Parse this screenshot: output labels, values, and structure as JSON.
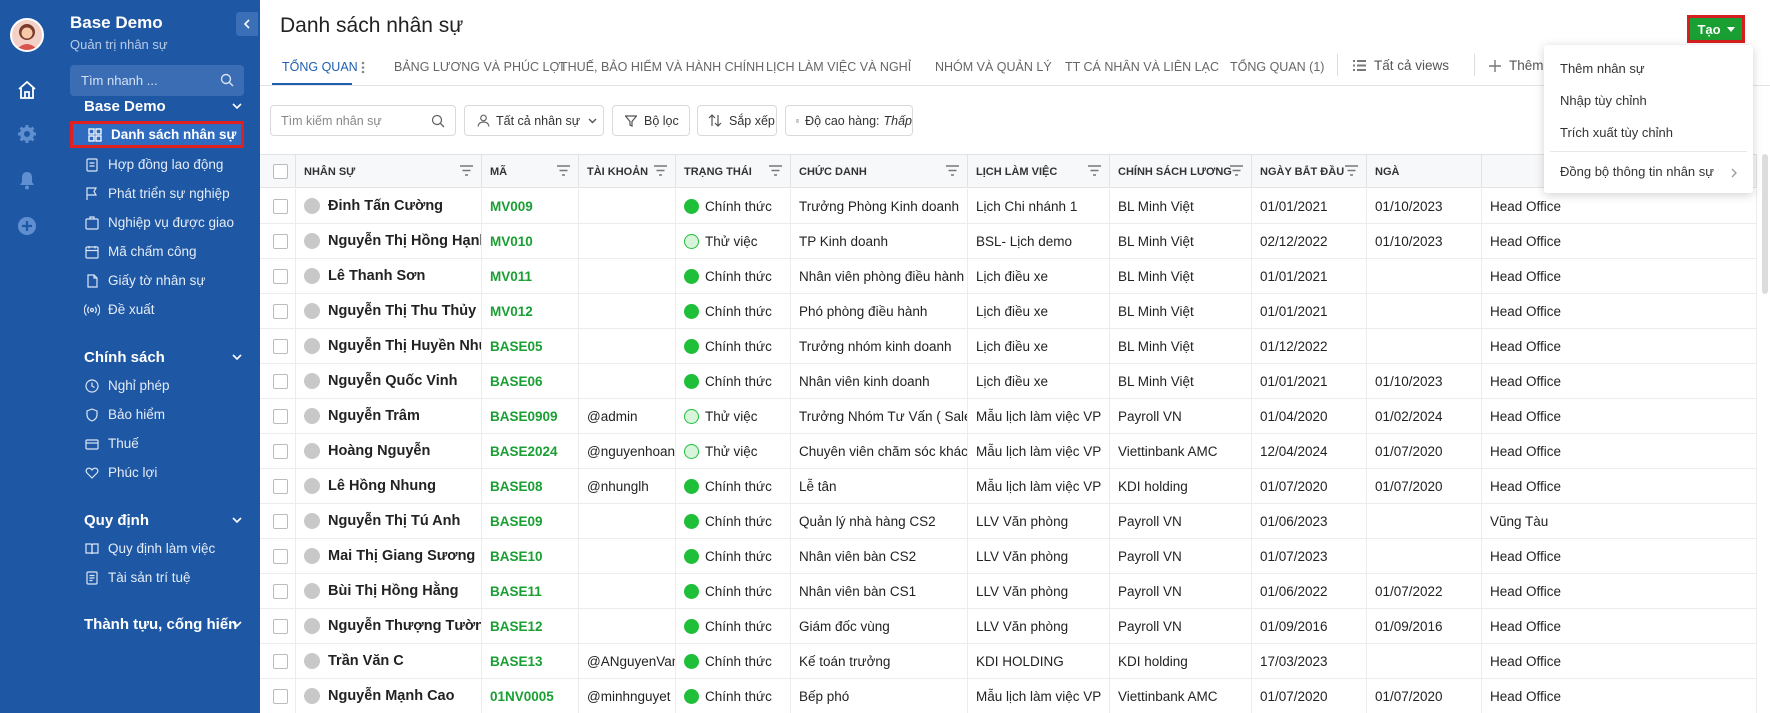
{
  "app": {
    "title": "Base Demo",
    "subtitle": "Quản trị nhân sự"
  },
  "colors": {
    "sidebar": "#1e57a4",
    "accent": "#1e5fb0",
    "create": "#1a9f33",
    "status": "#1fbf3a",
    "highlight": "#e02020"
  },
  "rail": {
    "icons": [
      "home-icon",
      "gear-icon",
      "bell-icon",
      "plus-circle-icon"
    ]
  },
  "sidebar": {
    "search_placeholder": "Tìm nhanh ...",
    "sections": [
      {
        "title": "Base Demo",
        "items": [
          {
            "label": "Danh sách nhân sự",
            "icon": "grid-icon",
            "active": true
          },
          {
            "label": "Hợp đồng lao động",
            "icon": "document-icon"
          },
          {
            "label": "Phát triển sự nghiệp",
            "icon": "flag-icon"
          },
          {
            "label": "Nghiệp vụ được giao",
            "icon": "task-icon"
          },
          {
            "label": "Mã chấm công",
            "icon": "calendar-icon"
          },
          {
            "label": "Giấy tờ nhân sự",
            "icon": "paper-icon"
          },
          {
            "label": "Đề xuất",
            "icon": "broadcast-icon"
          }
        ]
      },
      {
        "title": "Chính sách",
        "items": [
          {
            "label": "Nghỉ phép",
            "icon": "clock-icon"
          },
          {
            "label": "Bảo hiểm",
            "icon": "shield-icon"
          },
          {
            "label": "Thuế",
            "icon": "card-icon"
          },
          {
            "label": "Phúc lợi",
            "icon": "heart-icon"
          }
        ]
      },
      {
        "title": "Quy định",
        "items": [
          {
            "label": "Quy định làm việc",
            "icon": "book-icon"
          },
          {
            "label": "Tài sản trí tuệ",
            "icon": "file-icon"
          }
        ]
      },
      {
        "title": "Thành tựu, cống hiến",
        "items": []
      }
    ]
  },
  "main": {
    "title": "Danh sách nhân sự",
    "create_label": "Tạo",
    "tabs": [
      "TỔNG QUAN",
      "BẢNG LƯƠNG VÀ PHÚC LỢI",
      "THUẾ, BẢO HIỂM VÀ HÀNH CHÍNH",
      "LỊCH LÀM VIỆC VÀ NGHỈ",
      "NHÓM VÀ QUẢN LÝ",
      "TT CÁ NHÂN VÀ LIÊN LẠC",
      "TỔNG QUAN (1)"
    ],
    "all_views": "Tất cả views",
    "add_view": "Thêm",
    "toolbar": {
      "search_placeholder": "Tìm kiếm nhân sự",
      "scope": "Tất cả nhân sự",
      "filter": "Bộ lọc",
      "sort": "Sắp xếp",
      "row_height_label": "Độ cao hàng:",
      "row_height_value": "Thấp"
    },
    "dropdown": [
      "Thêm nhân sự",
      "Nhập tùy chỉnh",
      "Trích xuất tùy chỉnh",
      "Đồng bộ thông tin nhân sự"
    ]
  },
  "table": {
    "columns": [
      "NHÂN SỰ",
      "MÃ",
      "TÀI KHOẢN",
      "TRẠNG THÁI",
      "CHỨC DANH",
      "LỊCH LÀM VIỆC",
      "CHÍNH SÁCH LƯƠNG",
      "NGÀY BẮT ĐẦU",
      "NGÀ"
    ],
    "rows": [
      {
        "name": "Đinh Tấn Cường",
        "code": "MV009",
        "account": "",
        "status": "Chính thức",
        "title": "Trưởng Phòng Kinh doanh",
        "schedule": "Lịch Chi nhánh 1",
        "salary": "BL Minh Việt",
        "start": "01/01/2021",
        "end": "01/10/2023",
        "office": "Head Office"
      },
      {
        "name": "Nguyễn Thị Hồng Hạnh",
        "code": "MV010",
        "account": "",
        "status": "Thử việc",
        "title": "TP Kinh doanh",
        "schedule": "BSL- Lịch demo",
        "salary": "BL Minh Việt",
        "start": "02/12/2022",
        "end": "01/10/2023",
        "office": "Head Office"
      },
      {
        "name": "Lê Thanh Sơn",
        "code": "MV011",
        "account": "",
        "status": "Chính thức",
        "title": "Nhân viên phòng điều hành",
        "schedule": "Lịch điều xe",
        "salary": "BL Minh Việt",
        "start": "01/01/2021",
        "end": "",
        "office": "Head Office"
      },
      {
        "name": "Nguyễn Thị Thu Thủy",
        "code": "MV012",
        "account": "",
        "status": "Chính thức",
        "title": "Phó phòng điều hành",
        "schedule": "Lịch điều xe",
        "salary": "BL Minh Việt",
        "start": "01/01/2021",
        "end": "",
        "office": "Head Office"
      },
      {
        "name": "Nguyễn Thị Huyền Như",
        "code": "BASE05",
        "account": "",
        "status": "Chính thức",
        "title": "Trưởng nhóm kinh doanh",
        "schedule": "Lịch điều xe",
        "salary": "BL Minh Việt",
        "start": "01/12/2022",
        "end": "",
        "office": "Head Office"
      },
      {
        "name": "Nguyễn Quốc Vinh",
        "code": "BASE06",
        "account": "",
        "status": "Chính thức",
        "title": "Nhân viên kinh doanh",
        "schedule": "Lịch điều xe",
        "salary": "BL Minh Việt",
        "start": "01/01/2021",
        "end": "01/10/2023",
        "office": "Head Office"
      },
      {
        "name": "Nguyễn Trâm",
        "code": "BASE0909",
        "account": "@admin",
        "status": "Thử việc",
        "title": "Trưởng Nhóm Tư Vấn ( Sales ...",
        "schedule": "Mẫu lịch làm việc VP",
        "salary": "Payroll VN",
        "start": "01/04/2020",
        "end": "01/02/2024",
        "office": "Head Office"
      },
      {
        "name": "Hoàng Nguyễn",
        "code": "BASE2024",
        "account": "@nguyenhoang",
        "status": "Thử việc",
        "title": "Chuyên viên chăm sóc khách ...",
        "schedule": "Mẫu lịch làm việc VP",
        "salary": "Viettinbank AMC",
        "start": "12/04/2024",
        "end": "01/07/2020",
        "office": "Head Office"
      },
      {
        "name": "Lê Hồng Nhung",
        "code": "BASE08",
        "account": "@nhunglh",
        "status": "Chính thức",
        "title": "Lễ tân",
        "schedule": "Mẫu lịch làm việc VP",
        "salary": "KDI holding",
        "start": "01/07/2020",
        "end": "01/07/2020",
        "office": "Head Office"
      },
      {
        "name": "Nguyễn Thị Tú Anh",
        "code": "BASE09",
        "account": "",
        "status": "Chính thức",
        "title": "Quản lý nhà hàng CS2",
        "schedule": "LLV Văn phòng",
        "salary": "Payroll VN",
        "start": "01/06/2023",
        "end": "",
        "office": "Vũng Tàu"
      },
      {
        "name": "Mai Thị Giang Sương",
        "code": "BASE10",
        "account": "",
        "status": "Chính thức",
        "title": "Nhân viên bàn CS2",
        "schedule": "LLV Văn phòng",
        "salary": "Payroll VN",
        "start": "01/07/2023",
        "end": "",
        "office": "Head Office"
      },
      {
        "name": "Bùi Thị Hồng Hằng",
        "code": "BASE11",
        "account": "",
        "status": "Chính thức",
        "title": "Nhân viên bàn CS1",
        "schedule": "LLV Văn phòng",
        "salary": "Payroll VN",
        "start": "01/06/2022",
        "end": "01/07/2022",
        "office": "Head Office"
      },
      {
        "name": "Nguyễn Thượng Tường ...",
        "code": "BASE12",
        "account": "",
        "status": "Chính thức",
        "title": "Giám đốc vùng",
        "schedule": "LLV Văn phòng",
        "salary": "Payroll VN",
        "start": "01/09/2016",
        "end": "01/09/2016",
        "office": "Head Office"
      },
      {
        "name": "Trần Văn C",
        "code": "BASE13",
        "account": "@ANguyenVan",
        "status": "Chính thức",
        "title": "Kế toán trưởng",
        "schedule": "KDI HOLDING",
        "salary": "KDI holding",
        "start": "17/03/2023",
        "end": "",
        "office": "Head Office"
      },
      {
        "name": "Nguyễn Mạnh Cao",
        "code": "01NV0005",
        "account": "@minhnguyet",
        "status": "Chính thức",
        "title": "Bếp phó",
        "schedule": "Mẫu lịch làm việc VP",
        "salary": "Viettinbank AMC",
        "start": "01/07/2020",
        "end": "01/07/2020",
        "office": "Head Office"
      }
    ]
  }
}
